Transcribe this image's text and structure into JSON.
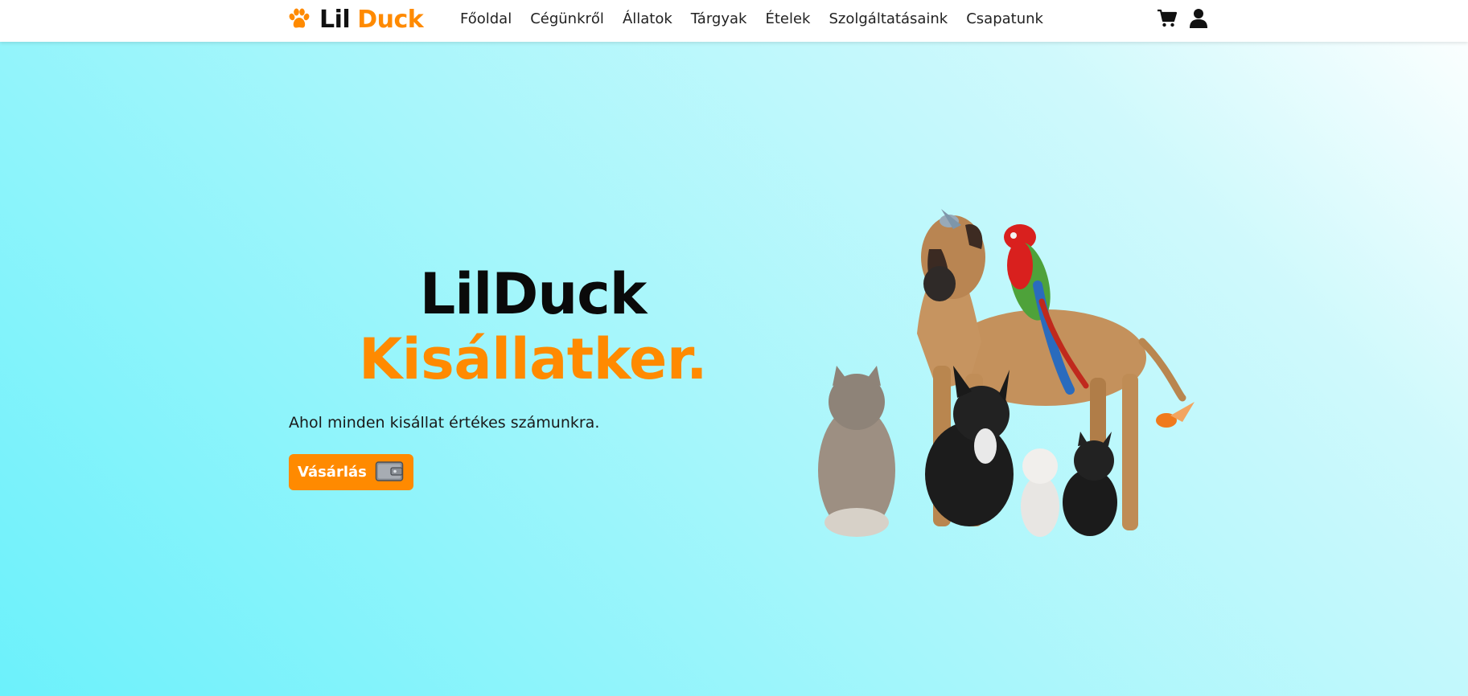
{
  "brand": {
    "word1": "Lil",
    "word2": "Duck",
    "icon": "paw-icon"
  },
  "nav": {
    "items": [
      "Főoldal",
      "Cégünkről",
      "Állatok",
      "Tárgyak",
      "Ételek",
      "Szolgáltatásaink",
      "Csapatunk"
    ],
    "icons": [
      "cart-icon",
      "user-icon"
    ]
  },
  "hero": {
    "title_line1": "LilDuck",
    "title_line2": "Kisállatker.",
    "subtitle": "Ahol minden kisállat értékes számunkra.",
    "button_label": "Vásárlás",
    "button_icon": "wallet-icon"
  },
  "colors": {
    "accent": "#ff8a00",
    "header_bg": "#ffffff",
    "gradient_start": "#6cf1fb",
    "gradient_end": "#ffffff"
  }
}
